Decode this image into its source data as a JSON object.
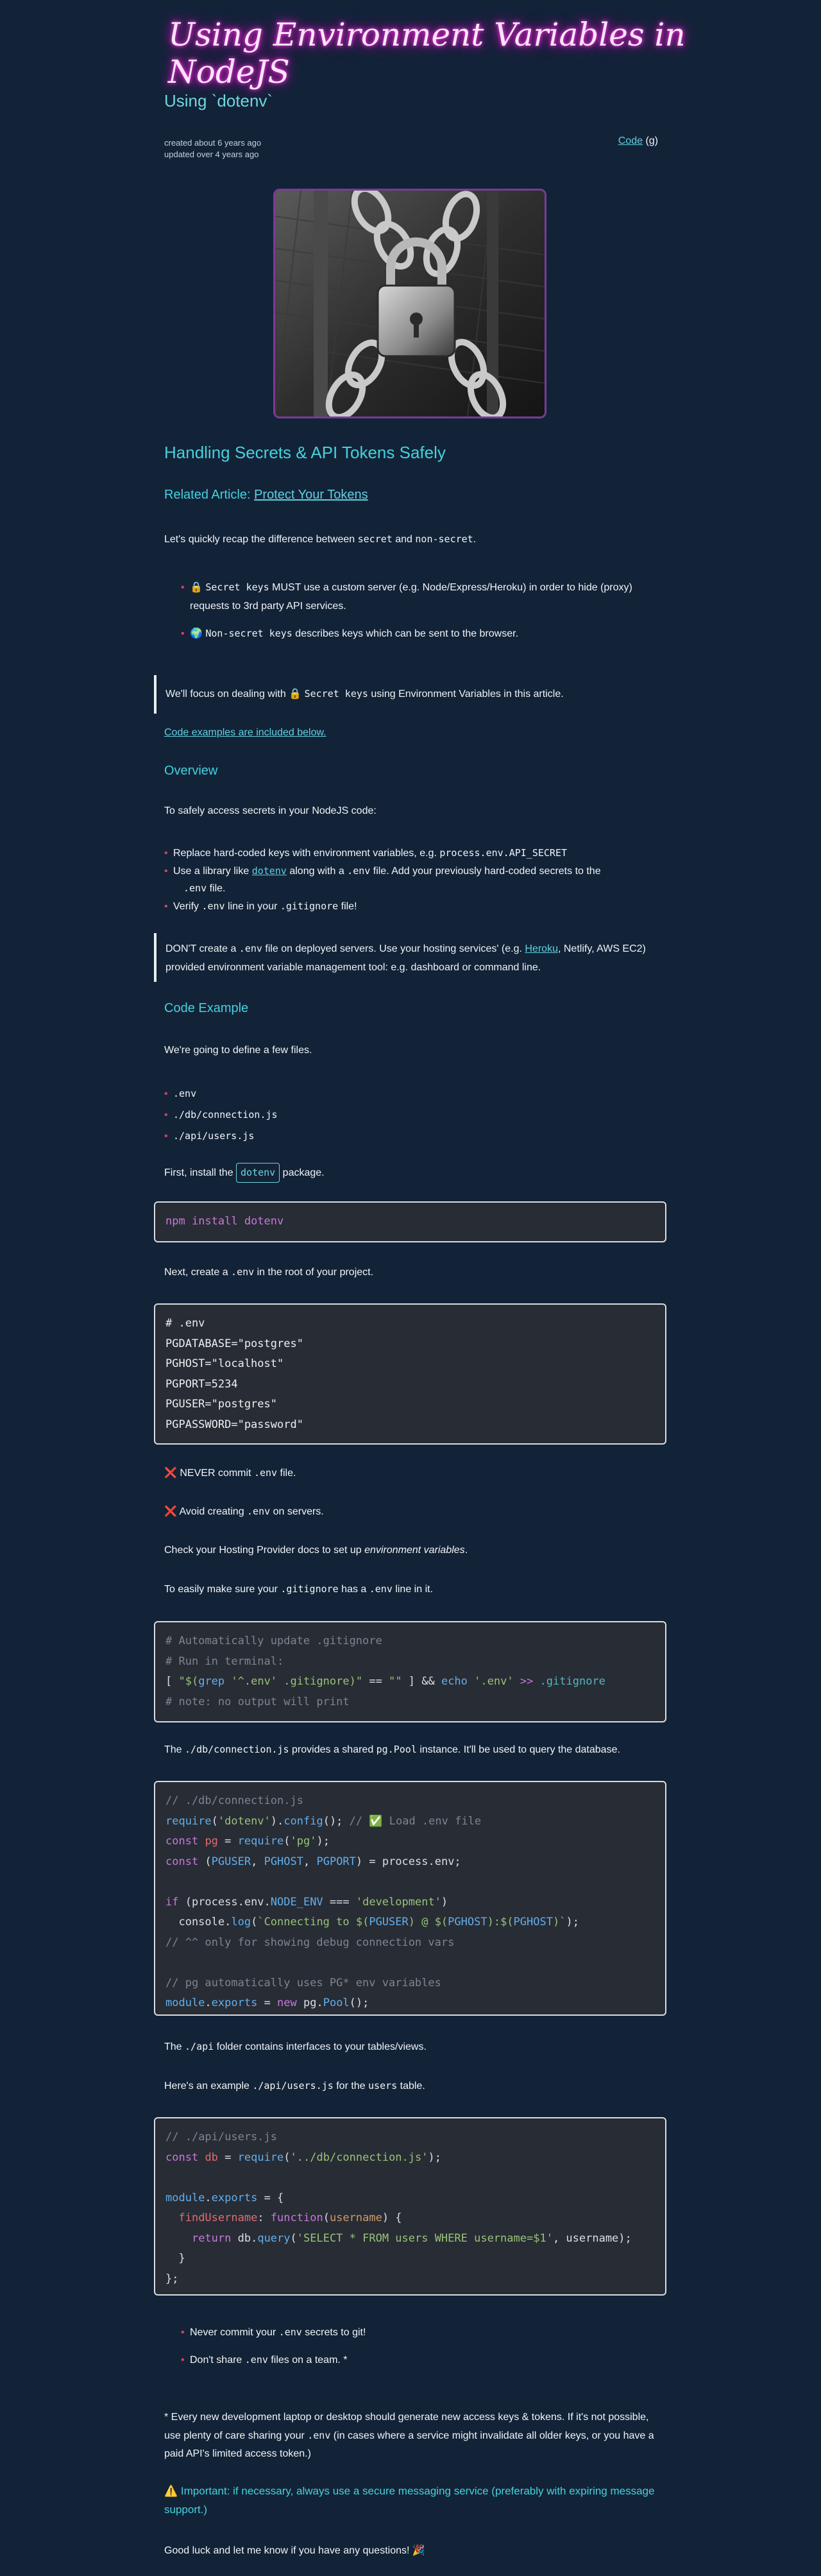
{
  "header": {
    "title": "Using Environment Variables in NodeJS",
    "subtitle": "Using `dotenv`",
    "created": "created about 6 years ago",
    "updated": "updated over 4 years ago",
    "code_link": "Code",
    "code_suffix": "(g)"
  },
  "hero": {
    "icon": "padlock-on-chain-image"
  },
  "section1": {
    "heading": "Handling Secrets & API Tokens Safely",
    "related_prefix": "Related Article: ",
    "related_link": "Protect Your Tokens",
    "recap_pre": "Let's quickly recap the difference between ",
    "recap_code1": "secret",
    "recap_mid": " and ",
    "recap_code2": "non-secret",
    "recap_post": ".",
    "bullet1_emoji": "🔒",
    "bullet1_code": "Secret keys",
    "bullet1_text": " MUST use a custom server (e.g. Node/Express/Heroku) in order to hide (proxy) requests to 3rd party API services.",
    "bullet2_emoji": "🌍",
    "bullet2_code": "Non-secret keys",
    "bullet2_text": " describes keys which can be sent to the browser.",
    "quote_pre": "We'll focus on dealing with ",
    "quote_emoji": "🔒",
    "quote_code": "Secret keys",
    "quote_post": " using Environment Variables in this article.",
    "examples_link": "Code examples are included below."
  },
  "overview": {
    "heading": "Overview",
    "intro": "To safely access secrets in your NodeJS code:",
    "item1_pre": "Replace hard-coded keys with environment variables, e.g. ",
    "item1_code": "process.env.API_SECRET",
    "item2_pre": "Use a library like ",
    "item2_link": "dotenv",
    "item2_mid": " along with a ",
    "item2_code1": ".env",
    "item2_post": " file. Add your previously hard-coded secrets to the ",
    "item2_code2": ".env",
    "item2_end": " file.",
    "item3_pre": "Verify ",
    "item3_code1": ".env",
    "item3_mid": " line in your ",
    "item3_code2": ".gitignore",
    "item3_post": " file!",
    "quote_pre": "DON'T create a ",
    "quote_code": ".env",
    "quote_mid": " file on deployed servers. Use your hosting services' (e.g. ",
    "quote_link": "Heroku",
    "quote_post": ", Netlify, AWS EC2) provided environment variable management tool: e.g. dashboard or command line."
  },
  "example": {
    "heading": "Code Example",
    "intro": "We're going to define a few files.",
    "files": [
      ".env",
      "./db/connection.js",
      "./api/users.js"
    ],
    "install_pre": "First, install the ",
    "install_link": "dotenv",
    "install_post": " package.",
    "npm_cmd": "npm",
    "npm_args": " install dotenv",
    "create_pre": "Next, create a ",
    "create_code": ".env",
    "create_post": " in the root of your project.",
    "env_lines": [
      "# .env",
      "PGDATABASE=\"postgres\"",
      "PGHOST=\"localhost\"",
      "PGPORT=5234",
      "PGUSER=\"postgres\"",
      "PGPASSWORD=\"password\""
    ],
    "never_emoji": "❌",
    "never_pre": "NEVER commit ",
    "never_code": ".env",
    "never_post": " file.",
    "avoid_emoji": "❌",
    "avoid_pre": "Avoid creating ",
    "avoid_code": ".env",
    "avoid_post": " on servers.",
    "check_pre": "Check your Hosting Provider docs to set up ",
    "check_em": "environment variables",
    "check_post": ".",
    "ensure_pre": "To easily make sure your ",
    "ensure_code1": ".gitignore",
    "ensure_mid": " has a ",
    "ensure_code2": ".env",
    "ensure_post": " line in it.",
    "git_c1": "# Automatically update .gitignore",
    "git_c2": "# Run in terminal:",
    "git_c3": "# note: no output will print",
    "conn_pre": "The ",
    "conn_code1": "./db/connection.js",
    "conn_mid": " provides a shared ",
    "conn_code2": "pg.Pool",
    "conn_post": " instance. It'll be used to query the database.",
    "conn_c1": "// ./db/connection.js",
    "conn_c2": "// ✅ Load .env file",
    "conn_c3": "// ^^ only for showing debug connection vars",
    "conn_c4": "// pg automatically uses PG* env variables",
    "api_pre": "The ",
    "api_code": "./api",
    "api_post": " folder contains interfaces to your tables/views.",
    "users_pre": "Here's an example ",
    "users_code1": "./api/users.js",
    "users_mid": " for the ",
    "users_code2": "users",
    "users_post": " table.",
    "users_c1": "// ./api/users.js"
  },
  "footer": {
    "b1_pre": "Never commit your ",
    "b1_code": ".env",
    "b1_post": " secrets to git!",
    "b2_pre": "Don't share ",
    "b2_code": ".env",
    "b2_post": " files on a team. *",
    "note_pre": "* Every new development laptop or desktop should generate new access keys & tokens. If it's not possible, use plenty of care sharing your ",
    "note_code": ".env",
    "note_post": " (in cases where a service might invalidate all older keys, or you have a paid API's limited access token.)",
    "important_emoji": "⚠️",
    "important": " Important: if necessary, always use a secure messaging service (preferably with expiring message support.)",
    "goodbye": "Good luck and let me know if you have any questions! 🎉"
  }
}
